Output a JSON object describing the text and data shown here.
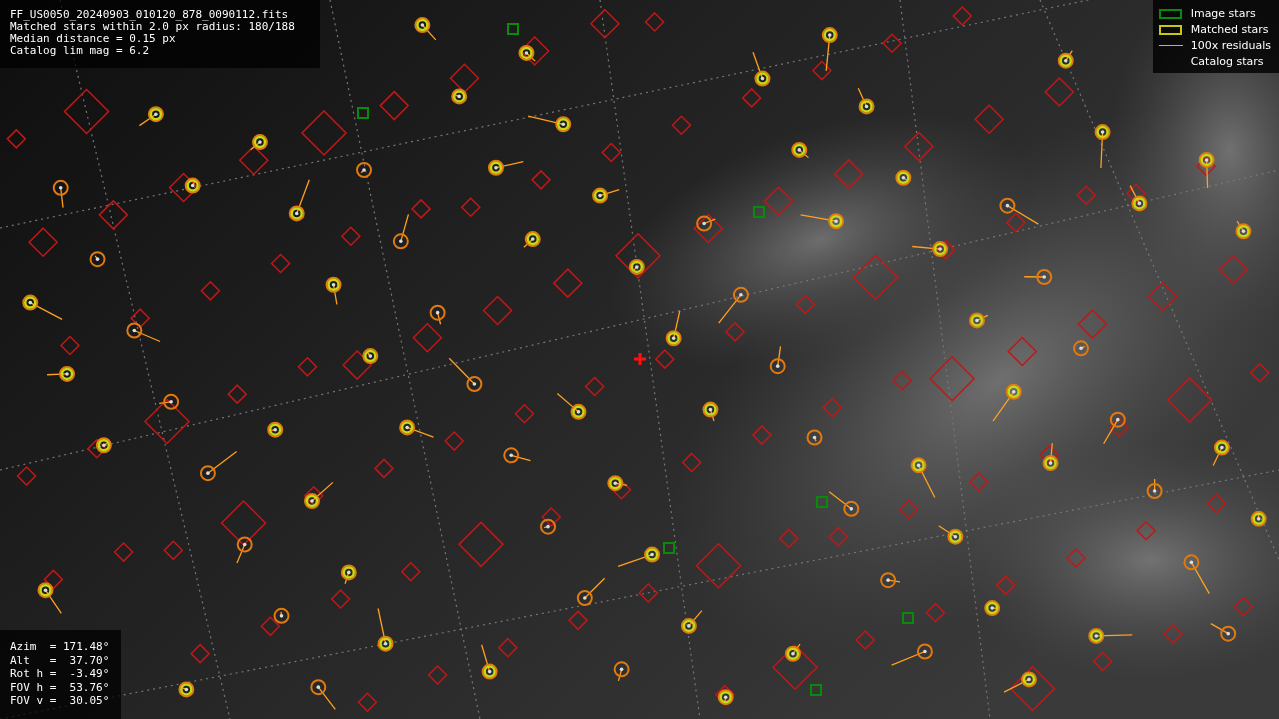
{
  "info": {
    "lines": [
      "FF_US0050_20240903_010120_878_0090112.fits",
      "Matched stars within 2.0 px radius: 180/188",
      "Median distance = 0.15 px",
      "Catalog lim mag = 6.2"
    ]
  },
  "legend": [
    {
      "label": "Image stars",
      "kind": "box",
      "color": "#0a8a0a"
    },
    {
      "label": "Matched stars",
      "kind": "box",
      "color": "#c8c814"
    },
    {
      "label": "100x residuals",
      "kind": "line",
      "color": "#ffa020"
    },
    {
      "label": "Catalog stars",
      "kind": "none"
    }
  ],
  "pointing": [
    "Azim  = 171.48°",
    "Alt   =  37.70°",
    "Rot h =  -3.49°",
    "FOV h =  53.76°",
    "FOV v =  30.05°"
  ]
}
